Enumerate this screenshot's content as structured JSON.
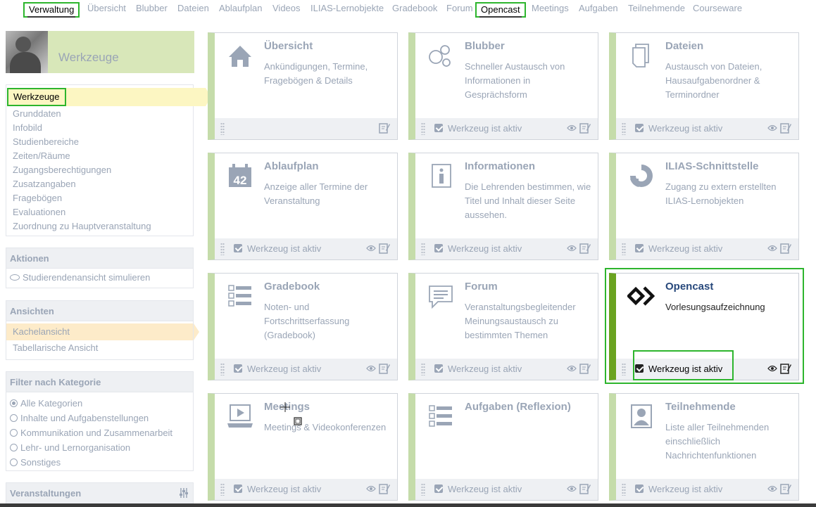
{
  "nav": {
    "tabs": [
      "Verwaltung",
      "Übersicht",
      "Blubber",
      "Dateien",
      "Ablaufplan",
      "Videos",
      "ILIAS-Lernobjekte",
      "Gradebook",
      "Forum",
      "Opencast",
      "Meetings",
      "Aufgaben",
      "Teilnehmende",
      "Courseware"
    ]
  },
  "sidebar": {
    "title": "Werkzeuge",
    "items": [
      "Werkzeuge",
      "Grunddaten",
      "Infobild",
      "Studienbereiche",
      "Zeiten/Räume",
      "Zugangsberechtigungen",
      "Zusatzangaben",
      "Fragebögen",
      "Evaluationen",
      "Zuordnung zu Hauptveranstaltung"
    ]
  },
  "aktionen": {
    "title": "Aktionen",
    "item": "Studierendenansicht simulieren"
  },
  "ansichten": {
    "title": "Ansichten",
    "items": [
      "Kachelansicht",
      "Tabellarische Ansicht"
    ]
  },
  "filter": {
    "title": "Filter nach Kategorie",
    "options": [
      "Alle Kategorien",
      "Inhalte und Aufgabenstellungen",
      "Kommunikation und Zusammenarbeit",
      "Lehr- und Lernorganisation",
      "Sonstiges"
    ]
  },
  "veranstaltungen": {
    "title": "Veranstaltungen"
  },
  "tiles": [
    {
      "title": "Übersicht",
      "desc": "Ankündigungen, Termine, Fragebögen & Details",
      "footer": "",
      "icon": "home-icon"
    },
    {
      "title": "Blubber",
      "desc": "Schneller Austausch von Informationen in Gesprächsform",
      "footer": "Werkzeug ist aktiv",
      "icon": "bubbles-icon"
    },
    {
      "title": "Dateien",
      "desc": "Austausch von Dateien, Hausaufgabenordner & Terminordner",
      "footer": "Werkzeug ist aktiv",
      "icon": "files-icon"
    },
    {
      "title": "Ablaufplan",
      "desc": "Anzeige aller Termine der Veranstaltung",
      "footer": "Werkzeug ist aktiv",
      "icon": "calendar-icon",
      "day": "42"
    },
    {
      "title": "Informationen",
      "desc": "Die Lehrenden bestimmen, wie Titel und Inhalt dieser Seite aussehen.",
      "footer": "Werkzeug ist aktiv",
      "icon": "info-icon"
    },
    {
      "title": "ILIAS-Schnittstelle",
      "desc": "Zugang zu extern erstellten ILIAS-Lernobjekten",
      "footer": "Werkzeug ist aktiv",
      "icon": "ilias-icon"
    },
    {
      "title": "Gradebook",
      "desc": "Noten- und Fortschrittserfassung (Gradebook)",
      "footer": "Werkzeug ist aktiv",
      "icon": "gradebook-icon"
    },
    {
      "title": "Forum",
      "desc": "Veranstaltungsbegleitender Meinungsaustausch zu bestimmten Themen",
      "footer": "Werkzeug ist aktiv",
      "icon": "forum-icon"
    },
    {
      "title": "Opencast",
      "desc": "Vorlesungsaufzeichnung",
      "footer": "Werkzeug ist aktiv",
      "icon": "opencast-icon"
    },
    {
      "title": "Meetings",
      "desc": "Meetings & Videokonferenzen",
      "footer": "Werkzeug ist aktiv",
      "icon": "meetings-icon"
    },
    {
      "title": "Aufgaben (Reflexion)",
      "desc": "",
      "footer": "Werkzeug ist aktiv",
      "icon": "tasks-icon"
    },
    {
      "title": "Teilnehmende",
      "desc": "Liste aller Teilnehmenden einschließlich Nachrichtenfunktionen",
      "footer": "Werkzeug ist aktiv",
      "icon": "participants-icon"
    }
  ]
}
